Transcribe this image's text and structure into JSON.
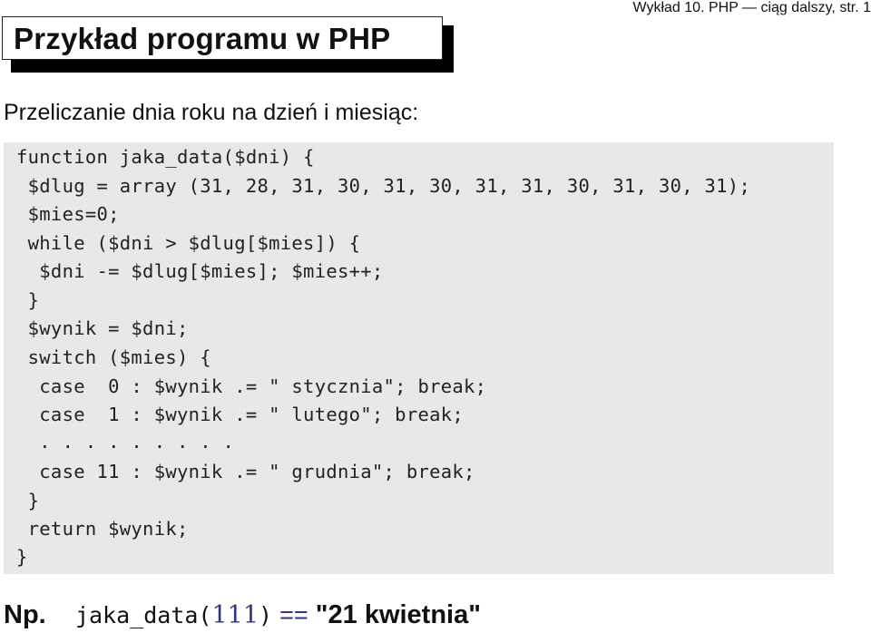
{
  "header": {
    "title": "Przykład programu w PHP",
    "lecture_info": "Wykład 10. PHP — ciąg dalszy, str. 1"
  },
  "subtitle": "Przeliczanie dnia roku na dzień i miesiąc:",
  "code": {
    "lines": [
      "function jaka_data($dni) {",
      " $dlug = array (31, 28, 31, 30, 31, 30, 31, 31, 30, 31, 30, 31);",
      " $mies=0;",
      " while ($dni > $dlug[$mies]) {",
      "  $dni -= $dlug[$mies]; $mies++;",
      " }",
      " $wynik = $dni;",
      " switch ($mies) {",
      "  case  0 : $wynik .= \" stycznia\"; break;",
      "  case  1 : $wynik .= \" lutego\"; break;",
      "  . . . . . . . . .",
      "  case 11 : $wynik .= \" grudnia\"; break;",
      " }",
      " return $wynik;",
      "}"
    ]
  },
  "example": {
    "label": "Np.",
    "call_prefix": "jaka_data(",
    "argument": "111",
    "call_suffix": ")",
    "operator": "==",
    "result": "\"21 kwietnia\""
  },
  "colors": {
    "code_background": "#e8e8e8",
    "accent": "#333388"
  }
}
